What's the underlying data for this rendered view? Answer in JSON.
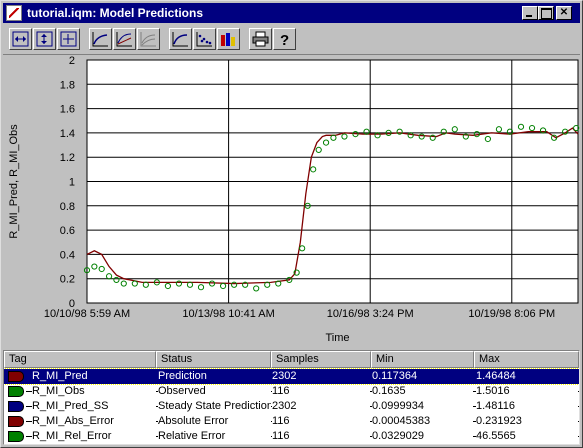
{
  "window": {
    "title": "tutorial.iqm: Model Predictions"
  },
  "toolbar": {
    "buttons": [
      {
        "name": "fit-horizontal-button",
        "icon": "fit-horizontal-icon"
      },
      {
        "name": "fit-vertical-button",
        "icon": "fit-vertical-icon"
      },
      {
        "name": "fit-both-button",
        "icon": "fit-both-icon"
      },
      {
        "name": "trend-view-button",
        "icon": "trend-icon"
      },
      {
        "name": "step-response-button",
        "icon": "step-response-icon"
      },
      {
        "name": "ramp-response-button",
        "icon": "ramp-response-icon"
      },
      {
        "name": "line-plot-button",
        "icon": "line-plot-icon"
      },
      {
        "name": "scatter-plot-button",
        "icon": "scatter-plot-icon"
      },
      {
        "name": "bar-chart-button",
        "icon": "bar-chart-icon"
      },
      {
        "name": "print-button",
        "icon": "printer-icon"
      },
      {
        "name": "help-button",
        "icon": "help-icon"
      }
    ]
  },
  "chart_data": {
    "type": "line",
    "ylabel": "R_MI_Pred, R_MI_Obs",
    "xlabel": "Time",
    "ylim": [
      0,
      2
    ],
    "y_ticks": [
      "0",
      "0.2",
      "0.4",
      "0.6",
      "0.8",
      "1",
      "1.2",
      "1.4",
      "1.6",
      "1.8",
      "2"
    ],
    "x_ticks": [
      "10/10/98 5:59 AM",
      "10/13/98 10:41 AM",
      "10/16/98 3:24 PM",
      "10/19/98 8:06 PM"
    ],
    "x_tick_values": [
      0,
      77,
      154,
      231
    ],
    "xlim": [
      0,
      267
    ],
    "grid": true,
    "series": [
      {
        "name": "R_MI_Pred",
        "style": "line",
        "color": "#800000",
        "x": [
          0,
          4,
          8,
          12,
          16,
          20,
          30,
          40,
          60,
          80,
          100,
          110,
          113,
          116,
          119,
          122,
          125,
          128,
          130,
          132,
          135,
          140,
          150,
          160,
          170,
          180,
          190,
          195,
          200,
          210,
          220,
          230,
          240,
          250,
          255,
          260,
          264,
          267
        ],
        "y": [
          0.4,
          0.43,
          0.4,
          0.3,
          0.23,
          0.2,
          0.17,
          0.17,
          0.17,
          0.16,
          0.17,
          0.19,
          0.24,
          0.5,
          0.9,
          1.2,
          1.32,
          1.37,
          1.38,
          1.38,
          1.38,
          1.4,
          1.39,
          1.39,
          1.4,
          1.38,
          1.37,
          1.4,
          1.39,
          1.38,
          1.4,
          1.39,
          1.41,
          1.41,
          1.36,
          1.4,
          1.44,
          1.39
        ]
      },
      {
        "name": "R_MI_Obs",
        "style": "markers",
        "color": "#008000",
        "x": [
          0,
          4,
          8,
          12,
          16,
          20,
          26,
          32,
          38,
          44,
          50,
          56,
          62,
          68,
          74,
          80,
          86,
          92,
          98,
          104,
          110,
          114,
          117,
          120,
          123,
          126,
          130,
          134,
          140,
          146,
          152,
          158,
          164,
          170,
          176,
          182,
          188,
          194,
          200,
          206,
          212,
          218,
          224,
          230,
          236,
          242,
          248,
          254,
          260,
          266
        ],
        "y": [
          0.27,
          0.3,
          0.28,
          0.22,
          0.19,
          0.16,
          0.16,
          0.15,
          0.17,
          0.14,
          0.16,
          0.15,
          0.13,
          0.16,
          0.14,
          0.15,
          0.15,
          0.12,
          0.15,
          0.16,
          0.19,
          0.25,
          0.45,
          0.8,
          1.1,
          1.26,
          1.32,
          1.36,
          1.37,
          1.39,
          1.41,
          1.38,
          1.4,
          1.41,
          1.38,
          1.37,
          1.36,
          1.41,
          1.43,
          1.37,
          1.39,
          1.35,
          1.43,
          1.41,
          1.45,
          1.44,
          1.42,
          1.36,
          1.41,
          1.44
        ]
      }
    ]
  },
  "table": {
    "headers": [
      "Tag",
      "Status",
      "Samples",
      "Min",
      "Max"
    ],
    "rows": [
      {
        "tag": "R_MI_Pred",
        "status": "Prediction",
        "samples": "2302",
        "min": "0.117364",
        "max": "1.46484",
        "color": "#800000",
        "selected": true
      },
      {
        "tag": "R_MI_Obs",
        "status": "Observed",
        "samples": "116",
        "min": "0.1635",
        "max": "1.5016",
        "color": "#008000",
        "selected": false
      },
      {
        "tag": "R_MI_Pred_SS",
        "status": "Steady State Prediction",
        "samples": "2302",
        "min": "0.0999934",
        "max": "1.48116",
        "color": "#000080",
        "selected": false
      },
      {
        "tag": "R_MI_Abs_Error",
        "status": "Absolute Error",
        "samples": "116",
        "min": "0.00045383",
        "max": "0.231923",
        "color": "#800000",
        "selected": false
      },
      {
        "tag": "R_MI_Rel_Error",
        "status": "Relative Error",
        "samples": "116",
        "min": "0.0329029",
        "max": "46.5565",
        "color": "#008000",
        "selected": false
      }
    ]
  }
}
